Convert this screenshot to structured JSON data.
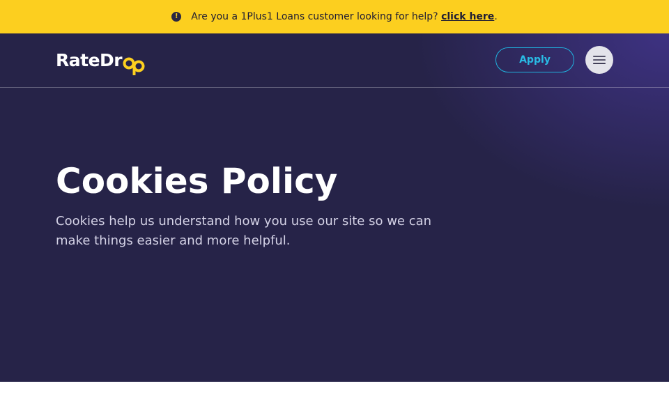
{
  "notice": {
    "icon": "alert-circle-icon",
    "text": "Are you a 1Plus1 Loans customer looking for help? ",
    "link_label": "click here",
    "trailing": ".",
    "background": "#fccf1f"
  },
  "header": {
    "logo_text": "RateDr",
    "logo_mark": "op",
    "logo_mark_color": "#fccf1f",
    "apply_label": "Apply",
    "apply_color": "#29bce6",
    "menu_icon": "hamburger-menu-icon"
  },
  "hero": {
    "title": "Cookies Policy",
    "subtitle": "Cookies help us understand how you use our site so we can make things easier and more helpful.",
    "background": "#262348"
  }
}
